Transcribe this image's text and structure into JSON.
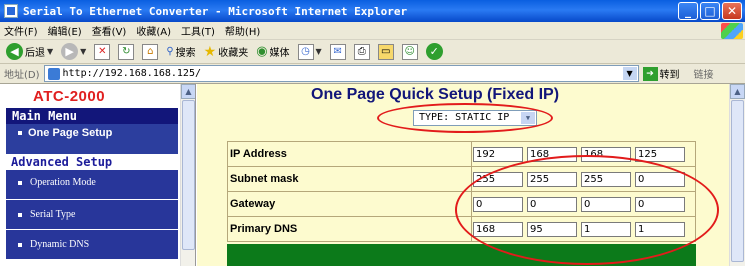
{
  "window": {
    "title": "Serial To Ethernet Converter - Microsoft Internet Explorer",
    "buttons": {
      "minimize": "_",
      "maximize": "□",
      "close": "✕"
    }
  },
  "menubar": {
    "items": [
      "文件(F)",
      "编辑(E)",
      "查看(V)",
      "收藏(A)",
      "工具(T)",
      "帮助(H)"
    ]
  },
  "toolbar": {
    "back_label": "后退",
    "search_label": "搜索",
    "favorites_label": "收藏夹",
    "media_label": "媒体"
  },
  "addressbar": {
    "label": "地址(D)",
    "url": "http://192.168.168.125/",
    "go_label": "转到",
    "links_label": "链接"
  },
  "sidebar": {
    "logo": "ATC-2000",
    "main_menu": "Main Menu",
    "selected_item": "One Page Setup",
    "advanced_setup": "Advanced Setup",
    "items": [
      {
        "label": "Operation Mode"
      },
      {
        "label": "Serial Type"
      },
      {
        "label": "Dynamic DNS"
      }
    ]
  },
  "main": {
    "title": "One Page Quick Setup (Fixed IP)",
    "type_select": "TYPE: STATIC IP",
    "rows": [
      {
        "label": "IP Address",
        "octets": [
          "192",
          "168",
          "168",
          "125"
        ]
      },
      {
        "label": "Subnet mask",
        "octets": [
          "255",
          "255",
          "255",
          "0"
        ]
      },
      {
        "label": "Gateway",
        "octets": [
          "0",
          "0",
          "0",
          "0"
        ]
      },
      {
        "label": "Primary DNS",
        "octets": [
          "168",
          "95",
          "1",
          "1"
        ]
      }
    ]
  },
  "colors": {
    "annotation": "#e21b1b",
    "sidebar_dark": "#12167a",
    "content_bg": "#fdfbcf",
    "logo": "#e02020"
  }
}
